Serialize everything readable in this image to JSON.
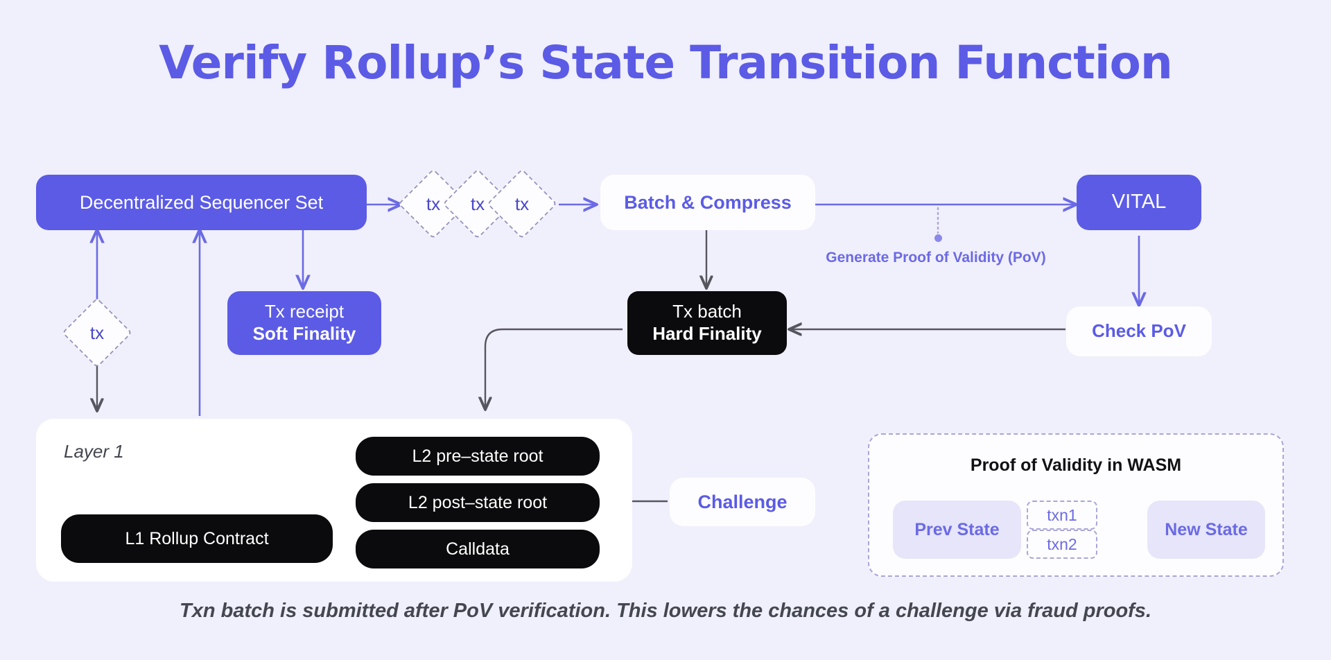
{
  "title": "Verify Rollup’s State Transition Function",
  "footer": "Txn batch is submitted after PoV verification. This lowers the chances of a challenge via fraud proofs.",
  "colors": {
    "background": "#f0effc",
    "accent_purple": "#5b5be6",
    "title_purple": "#5b5be6",
    "black_node": "#0b0b0d",
    "white_node": "#fdfdff",
    "lavender_pill": "#e6e5fa",
    "gray_arrow": "#55565e",
    "dashed_border": "#a9a6d8",
    "footer_text": "#44474f"
  },
  "nodes": {
    "sequencer_set": {
      "label": "Decentralized Sequencer Set",
      "style": "purple"
    },
    "tx_stream": {
      "labels": [
        "tx",
        "tx",
        "tx"
      ],
      "style": "dashed-diamond"
    },
    "batch_compress": {
      "label": "Batch & Compress",
      "style": "white"
    },
    "vital": {
      "label": "VITAL",
      "style": "purple"
    },
    "check_pov": {
      "label": "Check PoV",
      "style": "white"
    },
    "tx_receipt": {
      "label": "Tx receipt",
      "sublabel": "Soft Finality",
      "style": "purple"
    },
    "tx_batch": {
      "label": "Tx batch",
      "sublabel": "Hard Finality",
      "style": "black"
    },
    "tx_left": {
      "label": "tx",
      "style": "dashed-diamond"
    },
    "challenge": {
      "label": "Challenge",
      "style": "white"
    }
  },
  "annotations": {
    "pov_arrow_caption": "Generate Proof of Validity (PoV)"
  },
  "layer1": {
    "title": "Layer 1",
    "contract": "L1 Rollup Contract",
    "items": [
      "L2 pre–state root",
      "L2 post–state root",
      "Calldata"
    ]
  },
  "wasm": {
    "title": "Proof of Validity in WASM",
    "prev_state": "Prev State",
    "new_state": "New State",
    "txns": [
      "txn1",
      "txn2"
    ]
  }
}
